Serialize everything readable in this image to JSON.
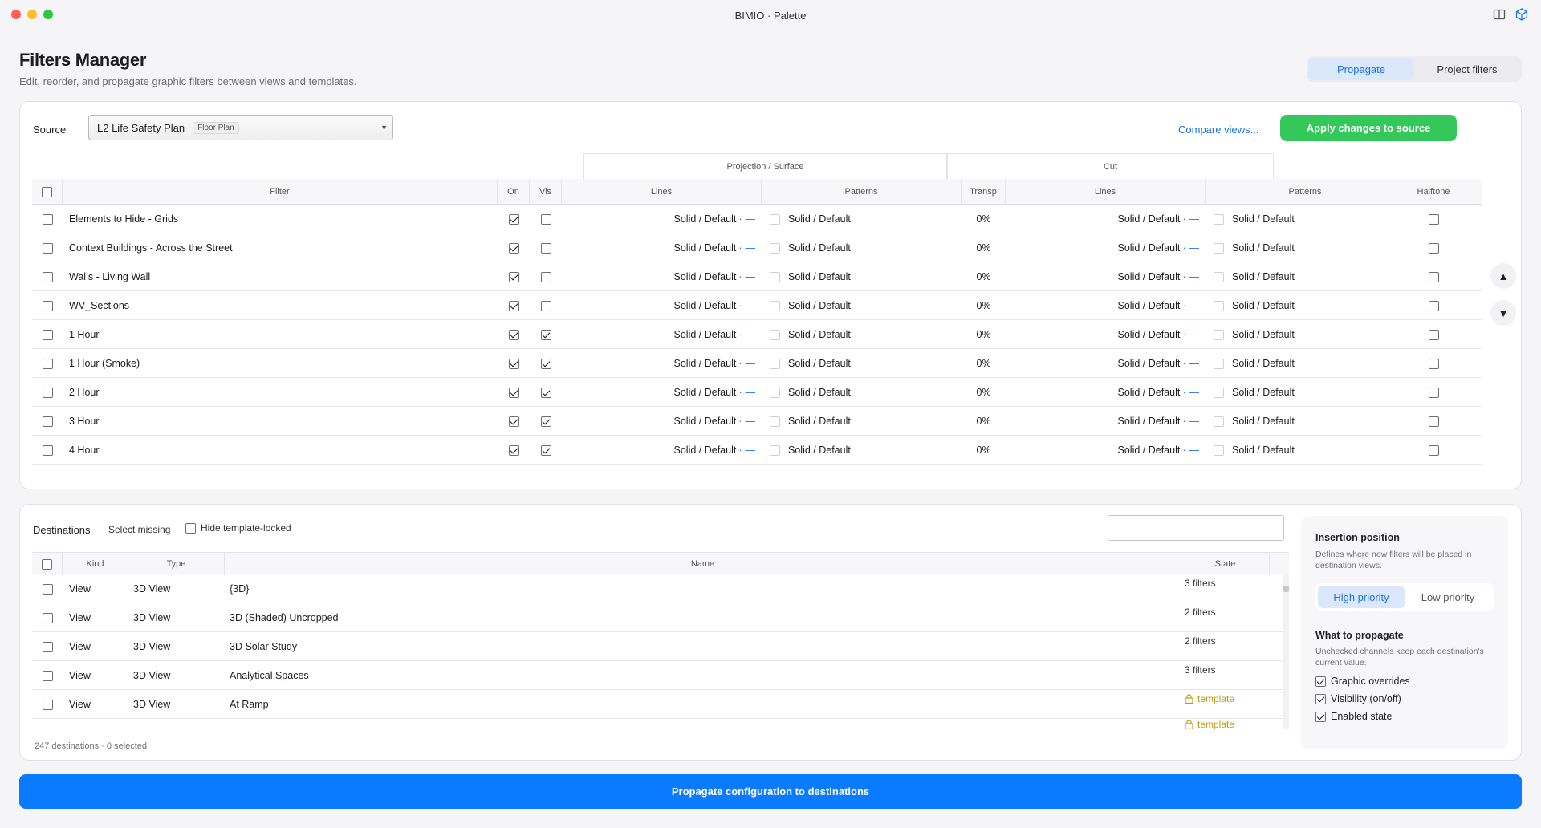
{
  "window": {
    "title": "BIMIO · Palette"
  },
  "header": {
    "title": "Filters Manager",
    "subtitle": "Edit, reorder, and propagate graphic filters between views and templates.",
    "tabs": [
      {
        "label": "Propagate",
        "active": true
      },
      {
        "label": "Project filters",
        "active": false
      }
    ]
  },
  "source": {
    "label": "Source",
    "selected": "L2 Life Safety Plan",
    "badge": "Floor Plan",
    "compare_link": "Compare views...",
    "apply_button": "Apply changes to source"
  },
  "filter_table": {
    "groups": [
      "Projection / Surface",
      "Cut"
    ],
    "columns": [
      "Filter",
      "On",
      "Vis",
      "Lines",
      "Patterns",
      "Transp",
      "Lines",
      "Patterns",
      "Halftone"
    ],
    "cell_text": {
      "lines": "Solid / Default",
      "patterns": "Solid / Default",
      "transp": "0%"
    },
    "line_suffix": "—",
    "line_sep": "·",
    "rows": [
      {
        "name": "Elements to Hide - Grids",
        "on": true,
        "vis": false
      },
      {
        "name": "Context Buildings - Across the Street",
        "on": true,
        "vis": false
      },
      {
        "name": "Walls - Living Wall",
        "on": true,
        "vis": false
      },
      {
        "name": "WV_Sections",
        "on": true,
        "vis": false
      },
      {
        "name": "1 Hour",
        "on": true,
        "vis": true
      },
      {
        "name": "1 Hour (Smoke)",
        "on": true,
        "vis": true
      },
      {
        "name": "2 Hour",
        "on": true,
        "vis": true
      },
      {
        "name": "3 Hour",
        "on": true,
        "vis": true
      },
      {
        "name": "4 Hour",
        "on": true,
        "vis": true
      }
    ],
    "move_up_icon": "triangle-up-icon",
    "move_down_icon": "triangle-down-icon"
  },
  "destinations": {
    "title": "Destinations",
    "select_missing": "Select missing",
    "hide_locked_label": "Hide template-locked",
    "columns": [
      "Kind",
      "Type",
      "Name",
      "State"
    ],
    "rows": [
      {
        "kind": "View",
        "type": "3D View",
        "name": "{3D}",
        "state": "3 filters",
        "locked": false
      },
      {
        "kind": "View",
        "type": "3D View",
        "name": "3D (Shaded) Uncropped",
        "state": "2 filters",
        "locked": false
      },
      {
        "kind": "View",
        "type": "3D View",
        "name": "3D Solar Study",
        "state": "2 filters",
        "locked": false
      },
      {
        "kind": "View",
        "type": "3D View",
        "name": "Analytical Spaces",
        "state": "3 filters",
        "locked": false
      },
      {
        "kind": "View",
        "type": "3D View",
        "name": "At Ramp",
        "state": "template",
        "locked": true
      }
    ],
    "partial_state": "template",
    "count_text": "247 destinations · 0 selected"
  },
  "insertion": {
    "title": "Insertion position",
    "description": "Defines where new filters will be placed in destination views.",
    "options": [
      {
        "label": "High priority",
        "active": true
      },
      {
        "label": "Low priority",
        "active": false
      }
    ]
  },
  "propagate_opts": {
    "title": "What to propagate",
    "description": "Unchecked channels keep each destination's current value.",
    "items": [
      {
        "label": "Graphic overrides",
        "checked": true
      },
      {
        "label": "Visibility (on/off)",
        "checked": true
      },
      {
        "label": "Enabled state",
        "checked": true
      }
    ]
  },
  "propagate_button": "Propagate configuration to destinations",
  "colors": {
    "accent": "#0a7aff",
    "apply_green": "#34c759",
    "template_gold": "#c49a1a"
  }
}
